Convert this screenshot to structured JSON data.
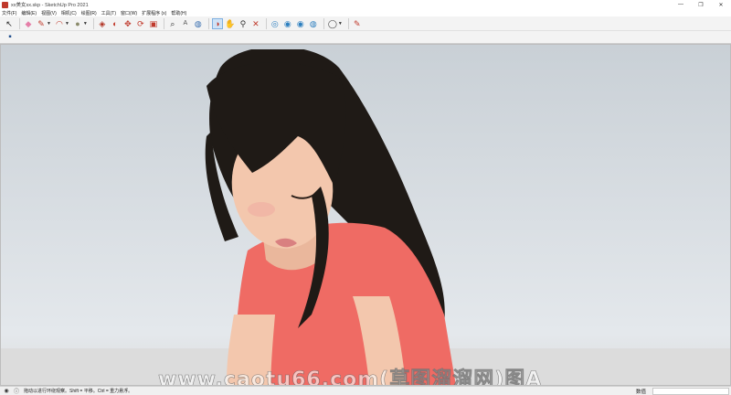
{
  "window": {
    "title": "xx美女sx.skp - SketchUp Pro 2021",
    "minimize": "—",
    "maximize": "❐",
    "close": "✕"
  },
  "menu": [
    "文件(F)",
    "编辑(E)",
    "视图(V)",
    "相机(C)",
    "绘图(R)",
    "工具(T)",
    "窗口(W)",
    "扩展程序 (x)",
    "帮助(H)"
  ],
  "toolbar": {
    "select": "↖",
    "eraser": "◆",
    "pencil": "✎",
    "arc": "◠",
    "shape": "●",
    "push_pull": "◈",
    "follow_me": "◐",
    "move": "✥",
    "rotate": "⟳",
    "scale": "▣",
    "tape": "⌕",
    "text": "A",
    "paint": "◍",
    "orbit": "◑",
    "pan": "✋",
    "zoom": "⚲",
    "zoom_extents": "✕",
    "walk": "◎",
    "look_around": "◉",
    "position_camera": "◉",
    "section": "◍",
    "account": "◯",
    "edit": "✎",
    "camera_views": "▪"
  },
  "watermark": "www.caotu66.com(草图溜溜网)图A",
  "status": {
    "text": "拖动以进行环绕观察。Shift = 平移。Ctrl = 重力悬浮。",
    "measure_label": "数值",
    "info_icon": "ⓘ",
    "geo_icon": "◉"
  },
  "colors": {
    "shirt": "#ef6b64",
    "hair": "#1f1a16",
    "skin": "#f3c7ad",
    "sky_top": "#c9d0d6",
    "ground": "#dcdcdc",
    "active_tool": "#cfe3f7"
  }
}
